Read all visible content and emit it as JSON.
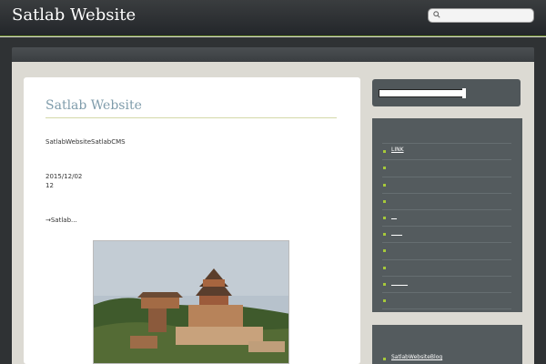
{
  "header": {
    "site_title": "Satlab Website",
    "search_placeholder": ""
  },
  "post": {
    "title": "Satlab Website",
    "subtitle": "SatlabWebsiteSatlabCMS",
    "date": "2015/12/02",
    "count": "12",
    "link_text": "→Satlab..."
  },
  "sidebar": {
    "items": [
      {
        "label": ""
      },
      {
        "label": "LINK"
      },
      {
        "label": ""
      },
      {
        "label": ""
      },
      {
        "label": ""
      },
      {
        "label": "__"
      },
      {
        "label": "____"
      },
      {
        "label": ""
      },
      {
        "label": ""
      },
      {
        "label": "______"
      },
      {
        "label": ""
      }
    ],
    "blog_link": "SatlabWebsiteBlog"
  },
  "colors": {
    "accent_green": "#a6c93a",
    "title_blue": "#7f9cab",
    "bar_dark": "#2f3234",
    "sidebar": "#545b5e"
  }
}
